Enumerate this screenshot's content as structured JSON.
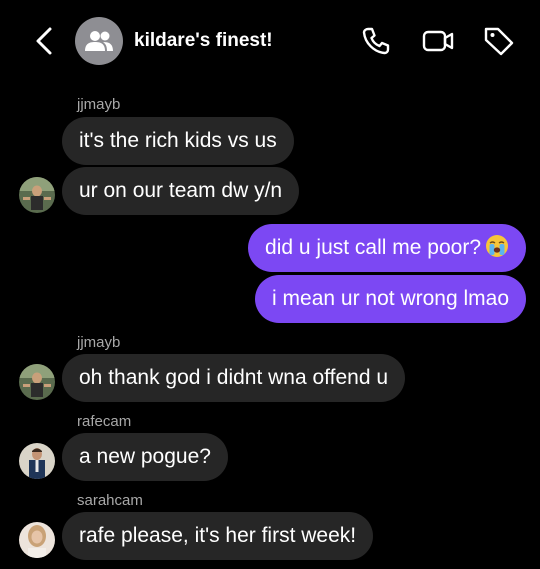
{
  "header": {
    "title": "kildare's finest!",
    "icons": [
      "back-chevron-icon",
      "group-people-icon",
      "phone-icon",
      "video-call-icon",
      "tag-icon"
    ]
  },
  "messages": [
    {
      "sender": "jjmayb",
      "text": "it's the rich kids vs us",
      "direction": "incoming"
    },
    {
      "text": "ur on our team dw y/n",
      "direction": "incoming"
    },
    {
      "text": "did u just call me poor?",
      "direction": "outgoing",
      "emoji": "loudly-crying-face"
    },
    {
      "text": "i mean ur not wrong lmao",
      "direction": "outgoing"
    },
    {
      "sender": "jjmayb",
      "text": "oh thank god i didnt wna offend u",
      "direction": "incoming"
    },
    {
      "sender": "rafecam",
      "text": "a new pogue?",
      "direction": "incoming"
    },
    {
      "sender": "sarahcam",
      "text": "rafe please, it's her first week!",
      "direction": "incoming"
    }
  ],
  "colors": {
    "background": "#000000",
    "incoming_bubble": "#262626",
    "outgoing_bubble": "#7c48f3",
    "sender_label": "#a8a8a8"
  }
}
